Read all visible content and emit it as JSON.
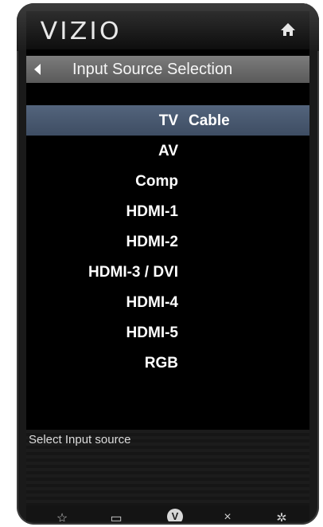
{
  "header": {
    "logo": "VIZIO",
    "home_icon": "home-icon"
  },
  "titlebar": {
    "title": "Input Source Selection",
    "back_icon": "back-arrow-icon"
  },
  "inputs": [
    {
      "label": "TV",
      "extra": "Cable",
      "selected": true
    },
    {
      "label": "AV",
      "extra": "",
      "selected": false
    },
    {
      "label": "Comp",
      "extra": "",
      "selected": false
    },
    {
      "label": "HDMI-1",
      "extra": "",
      "selected": false
    },
    {
      "label": "HDMI-2",
      "extra": "",
      "selected": false
    },
    {
      "label": "HDMI-3 / DVI",
      "extra": "",
      "selected": false
    },
    {
      "label": "HDMI-4",
      "extra": "",
      "selected": false
    },
    {
      "label": "HDMI-5",
      "extra": "",
      "selected": false
    },
    {
      "label": "RGB",
      "extra": "",
      "selected": false
    }
  ],
  "help": {
    "text": "Select Input source"
  },
  "navbar": {
    "buttons": [
      {
        "icon": "star-icon",
        "glyph": "☆",
        "line_color": "#3a3a3a"
      },
      {
        "icon": "screen-icon",
        "glyph": "▭",
        "line_color": "#1f6fc8"
      },
      {
        "icon": "vizio-v-icon",
        "glyph": "V",
        "line_color": ""
      },
      {
        "icon": "close-icon",
        "glyph": "×",
        "line_color": "#c8205a"
      },
      {
        "icon": "gear-icon",
        "glyph": "✲",
        "line_color": "#3a3a3a"
      }
    ]
  },
  "colors": {
    "selection": "#4b5b72",
    "titlebar": "#6e6e6e",
    "screen_bg": "#000000"
  }
}
